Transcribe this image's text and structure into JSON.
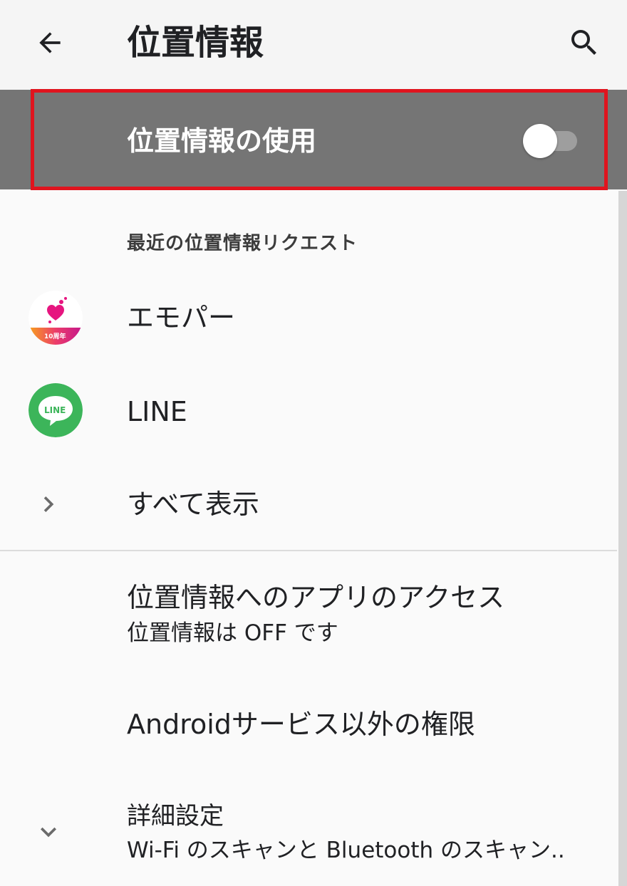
{
  "appbar": {
    "title": "位置情報",
    "back_icon": "arrow-left-icon",
    "search_icon": "search-icon"
  },
  "master_switch": {
    "label": "位置情報の使用",
    "state": "off"
  },
  "recent_requests": {
    "header": "最近の位置情報リクエスト",
    "apps": [
      {
        "name": "エモパー",
        "icon": "emopa-app-icon",
        "badge": "10周年"
      },
      {
        "name": "LINE",
        "icon": "line-app-icon",
        "icon_text": "LINE"
      }
    ],
    "see_all": "すべて表示"
  },
  "settings": {
    "app_access": {
      "title": "位置情報へのアプリのアクセス",
      "summary": "位置情報は OFF です"
    },
    "non_android_permissions": {
      "title": "Androidサービス以外の権限"
    },
    "advanced": {
      "title": "詳細設定",
      "summary": "Wi-Fi のスキャンと Bluetooth のスキャン.."
    }
  },
  "colors": {
    "master_bar": "#757575",
    "highlight": "#e0141e",
    "line_green": "#3cb55a",
    "emopa_pink": "#e6157f"
  }
}
